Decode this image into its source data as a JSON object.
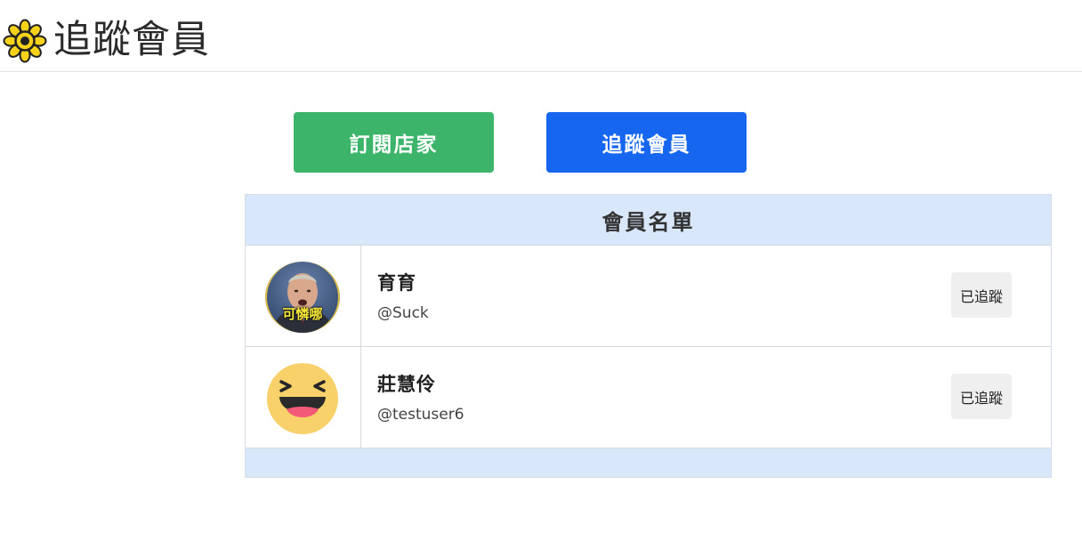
{
  "header": {
    "title": "追蹤會員",
    "logo_icon": "sun-flower-icon"
  },
  "tabs": {
    "shops_label": "訂閱店家",
    "members_label": "追蹤會員"
  },
  "colors": {
    "green": "#3cb56a",
    "blue": "#1666f0",
    "panel_bg": "#d9e7fb"
  },
  "member_list": {
    "title": "會員名單",
    "members": [
      {
        "name": "育育",
        "handle": "@Suck",
        "follow_label": "已追蹤",
        "avatar": "photo-avatar",
        "avatar_caption": "可憐哪"
      },
      {
        "name": "莊慧伶",
        "handle": "@testuser6",
        "follow_label": "已追蹤",
        "avatar": "laughing-emoji-avatar"
      }
    ]
  }
}
